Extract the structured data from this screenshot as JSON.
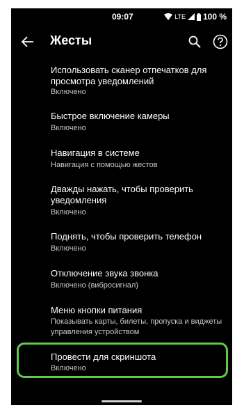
{
  "status_bar": {
    "time": "09:07",
    "network": "LTE",
    "battery": "100 %"
  },
  "header": {
    "title": "Жесты"
  },
  "items": [
    {
      "title": "Использовать сканер отпечатков для просмотра уведомлений",
      "subtitle": "Включено"
    },
    {
      "title": "Быстрое включение камеры",
      "subtitle": "Включено"
    },
    {
      "title": "Навигация в системе",
      "subtitle": "Навигация с помощью жестов"
    },
    {
      "title": "Дважды нажать, чтобы проверить уведомления",
      "subtitle": "Включено"
    },
    {
      "title": "Поднять, чтобы проверить телефон",
      "subtitle": "Включено"
    },
    {
      "title": "Отключение звука звонка",
      "subtitle": "Включено (вибросигнал)"
    },
    {
      "title": "Меню кнопки питания",
      "subtitle": "Показывать карты, билеты, пропуска и виджеты управления устройством"
    },
    {
      "title": "Провести для скриншота",
      "subtitle": "Включено"
    }
  ],
  "colors": {
    "background": "#000000",
    "highlight": "#63c94b",
    "text": "#ffffff",
    "secondary_text": "#c8c8c8"
  }
}
